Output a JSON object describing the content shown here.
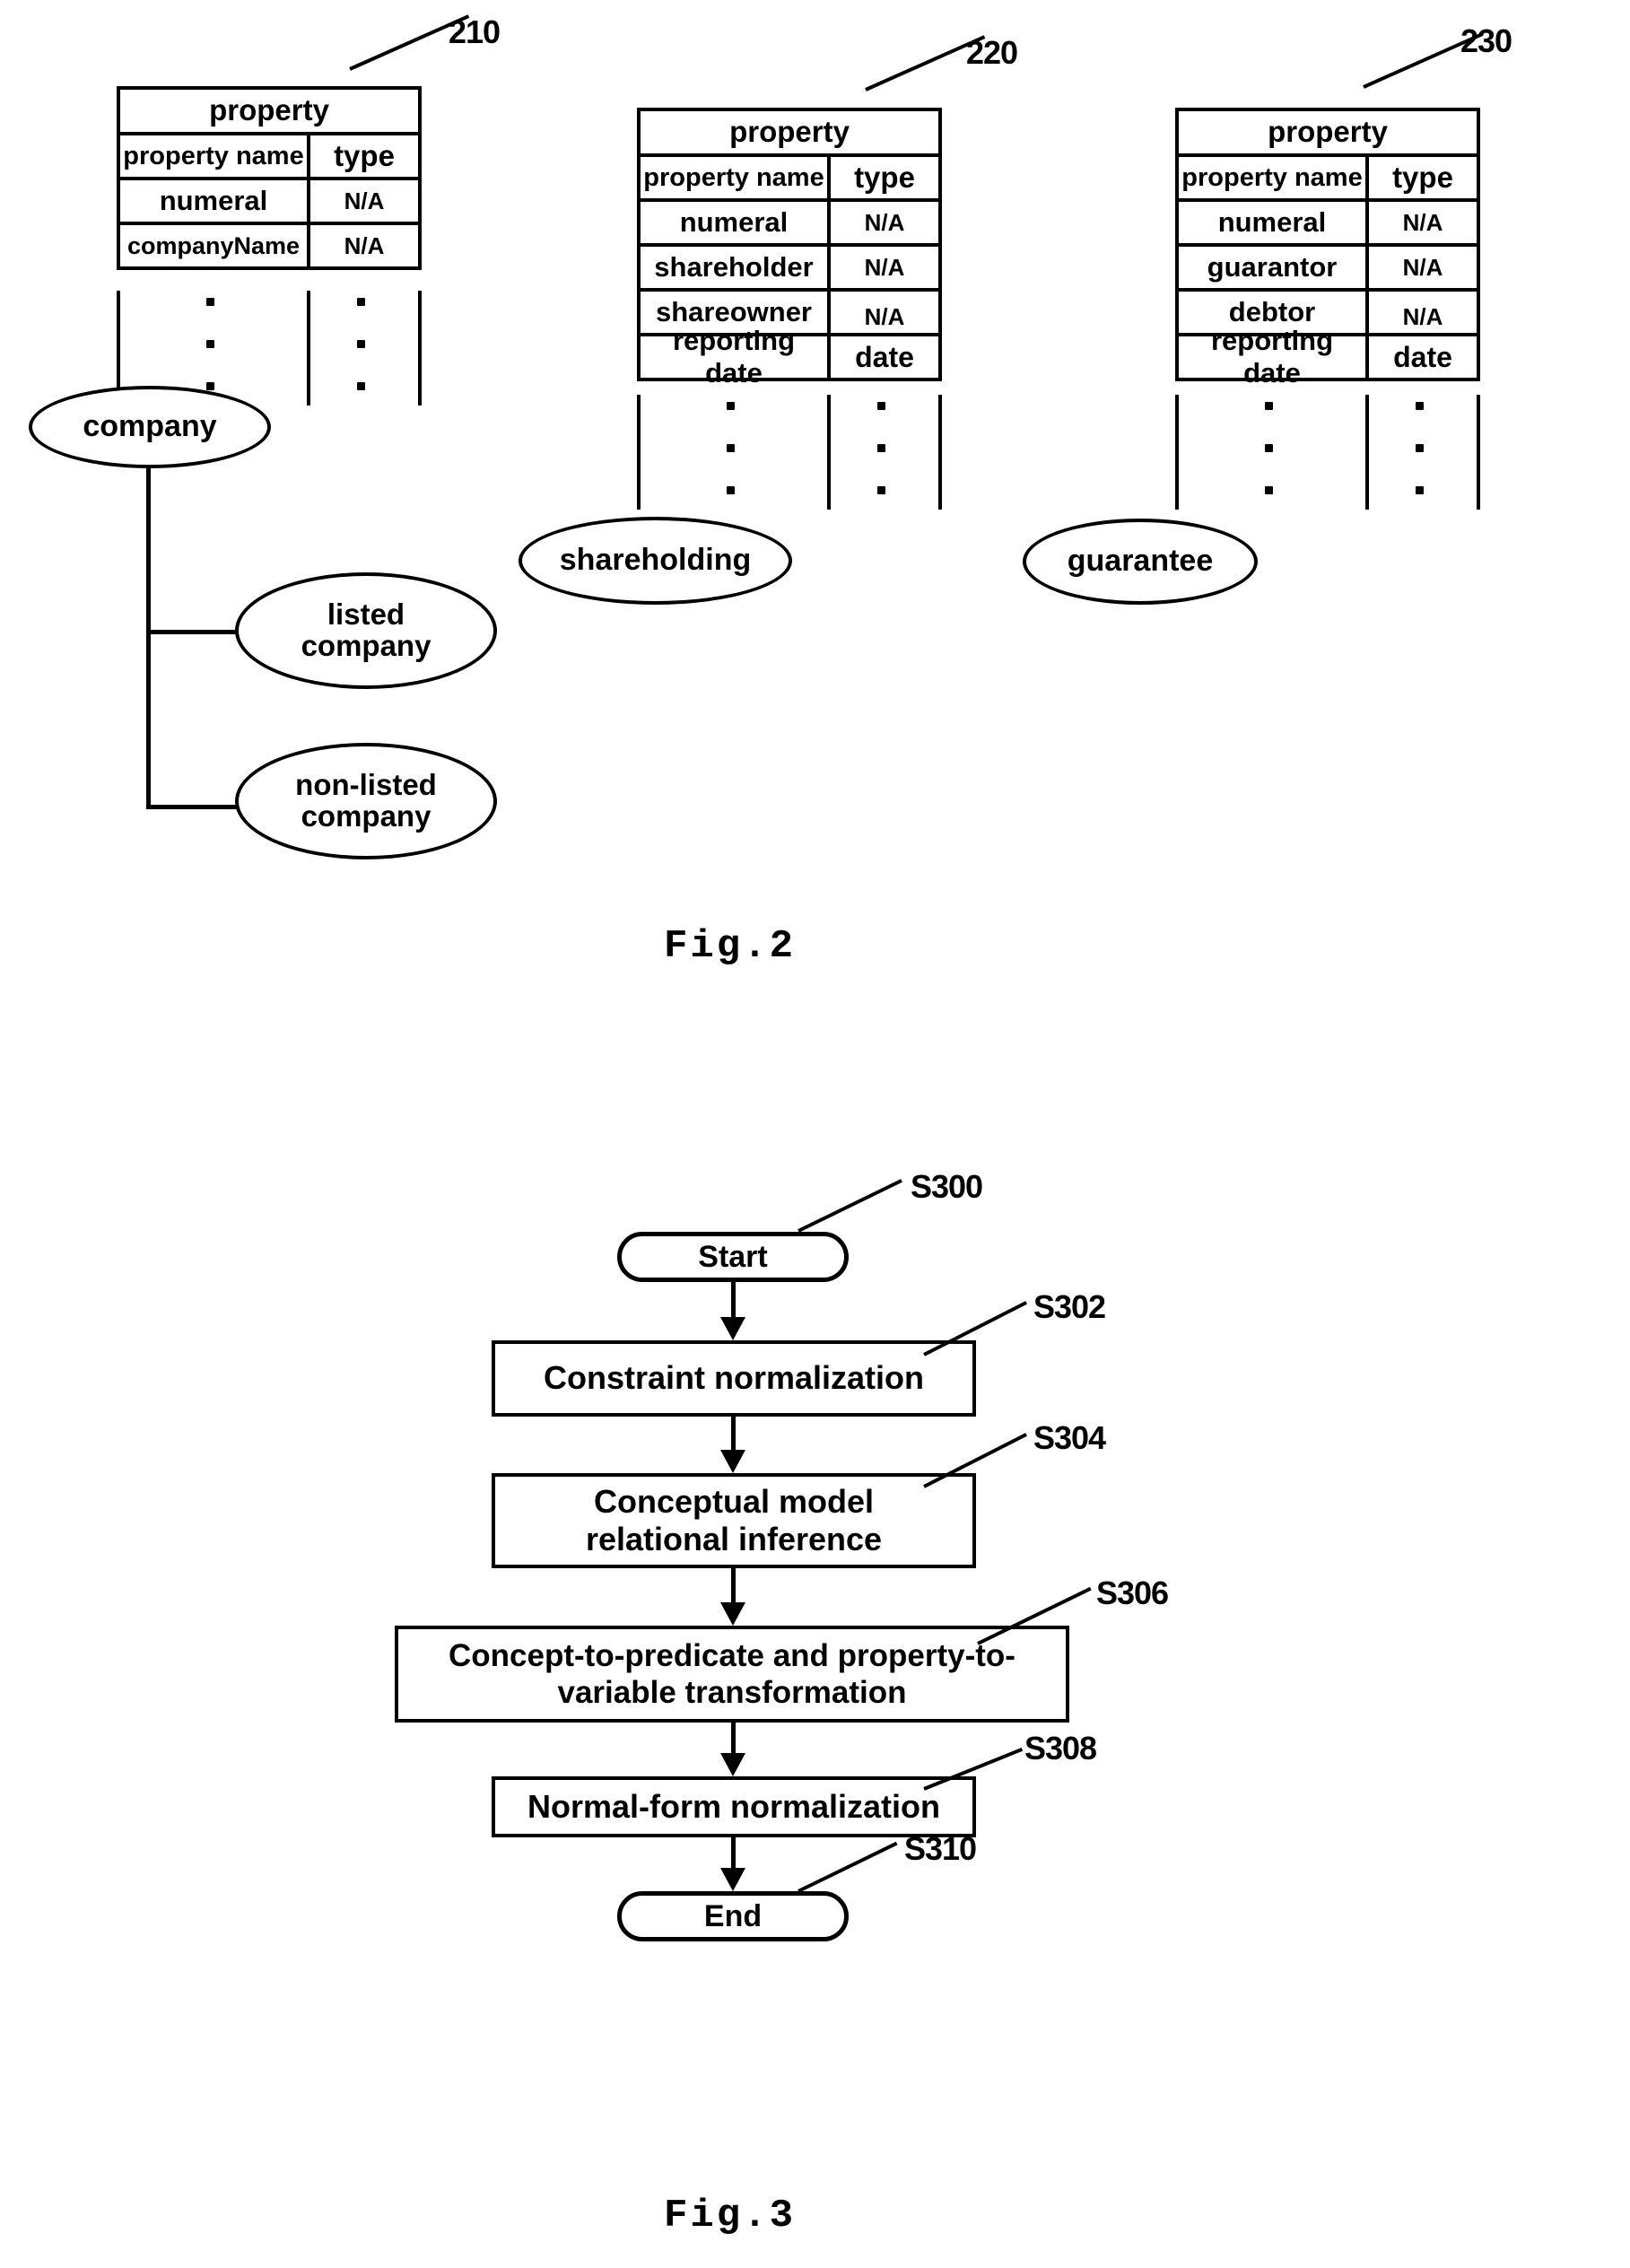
{
  "figures": [
    {
      "id": "fig2",
      "caption": "Fig.2"
    },
    {
      "id": "fig3",
      "caption": "Fig.3"
    }
  ],
  "fig2": {
    "caption": "Fig.2",
    "tables": [
      {
        "ref": "210",
        "title": "property",
        "columns": [
          "property name",
          "type"
        ],
        "rows": [
          [
            "numeral",
            "N/A"
          ],
          [
            "companyName",
            "N/A"
          ]
        ],
        "continuation": "vertical-ellipsis"
      },
      {
        "ref": "220",
        "title": "property",
        "columns": [
          "property name",
          "type"
        ],
        "rows": [
          [
            "numeral",
            "N/A"
          ],
          [
            "shareholder",
            "N/A"
          ],
          [
            "shareowner",
            "N/A"
          ],
          [
            "reporting date",
            "date"
          ]
        ],
        "continuation": "vertical-ellipsis"
      },
      {
        "ref": "230",
        "title": "property",
        "columns": [
          "property name",
          "type"
        ],
        "rows": [
          [
            "numeral",
            "N/A"
          ],
          [
            "guarantor",
            "N/A"
          ],
          [
            "debtor",
            "N/A"
          ],
          [
            "reporting date",
            "date"
          ]
        ],
        "continuation": "vertical-ellipsis"
      }
    ],
    "concepts": [
      {
        "id": "company",
        "label": "company"
      },
      {
        "id": "listed-company",
        "label": "listed\ncompany"
      },
      {
        "id": "non-listed-company",
        "label": "non-listed\ncompany"
      },
      {
        "id": "shareholding",
        "label": "shareholding"
      },
      {
        "id": "guarantee",
        "label": "guarantee"
      }
    ],
    "hierarchy": {
      "parent": "company",
      "children": [
        "listed company",
        "non-listed company"
      ]
    }
  },
  "fig3": {
    "caption": "Fig.3",
    "steps": [
      {
        "ref": "S300",
        "label": "Start",
        "shape": "terminator"
      },
      {
        "ref": "S302",
        "label": "Constraint normalization",
        "shape": "process"
      },
      {
        "ref": "S304",
        "label": "Conceptual model\nrelational inference",
        "shape": "process"
      },
      {
        "ref": "S306",
        "label": "Concept-to-predicate and property-to-\nvariable transformation",
        "shape": "process"
      },
      {
        "ref": "S308",
        "label": "Normal-form normalization",
        "shape": "process"
      },
      {
        "ref": "S310",
        "label": "End",
        "shape": "terminator"
      }
    ]
  },
  "colors": {
    "ink": "#000000",
    "paper": "#ffffff"
  }
}
